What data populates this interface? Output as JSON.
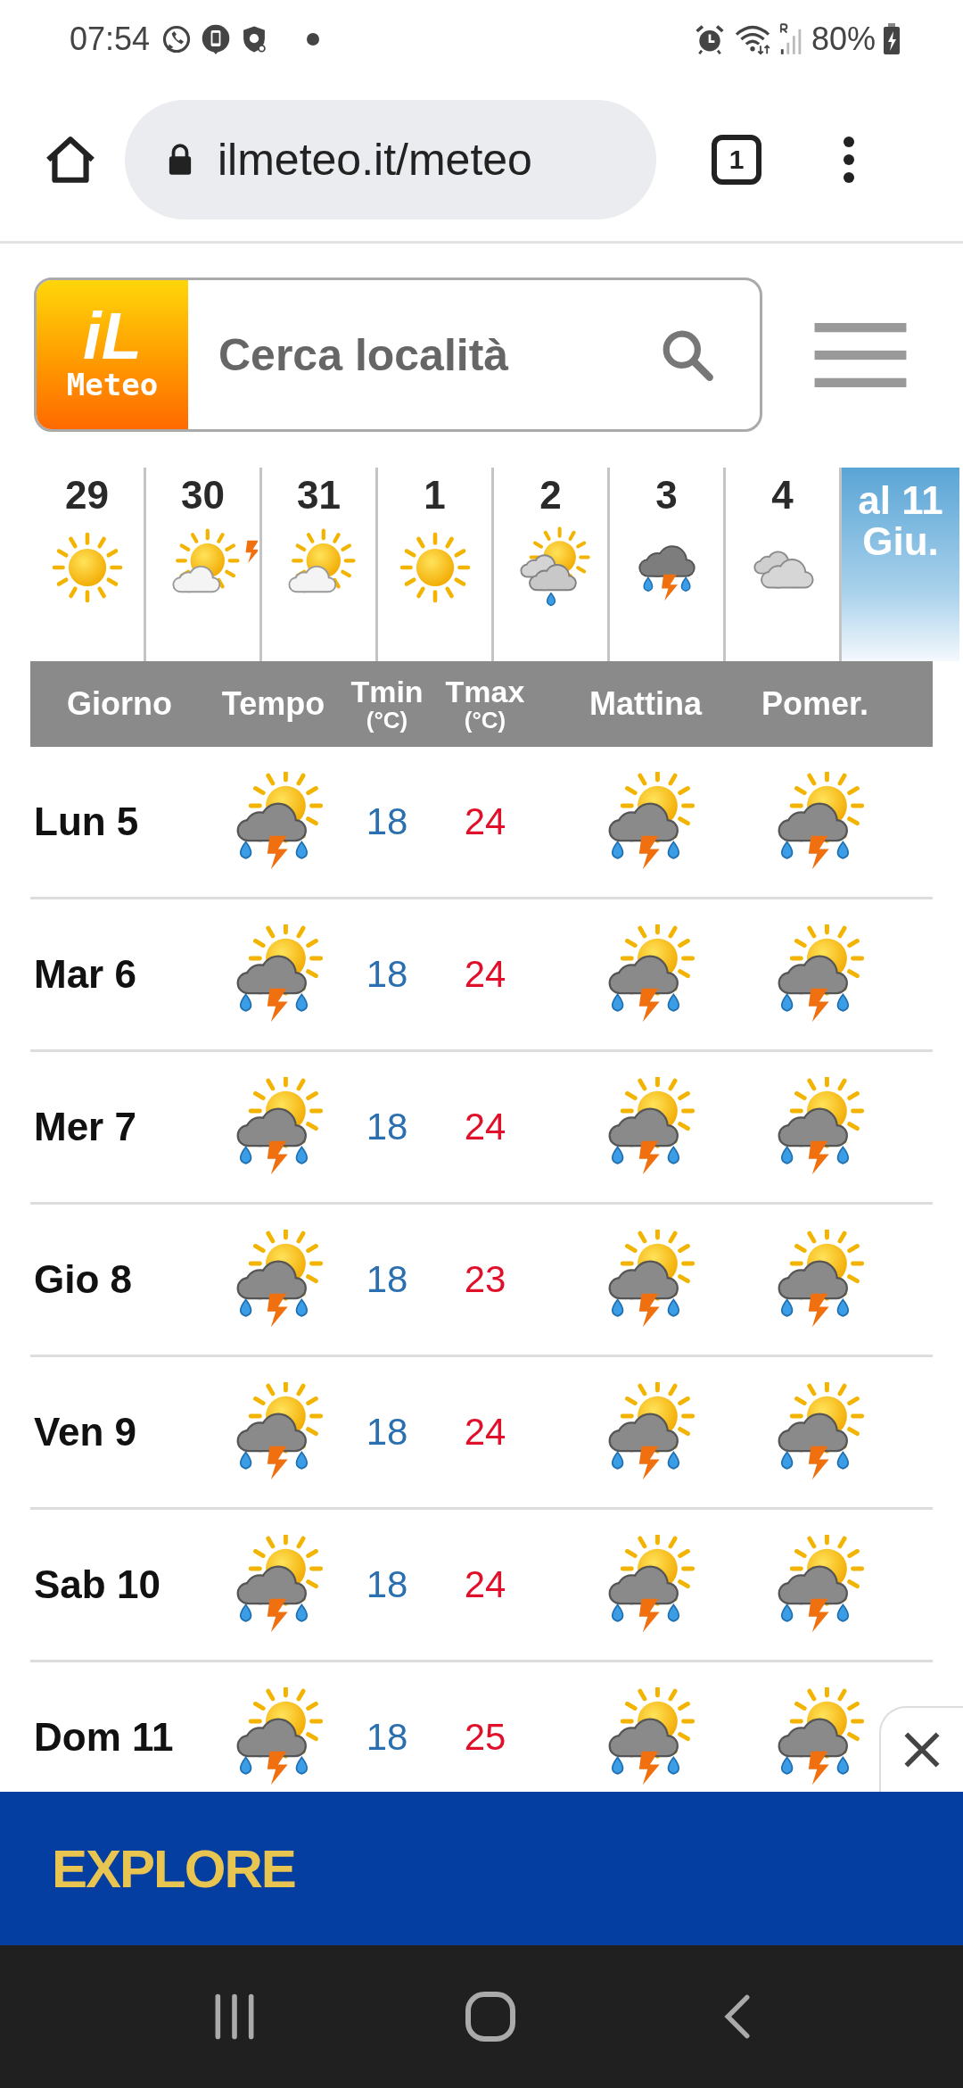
{
  "status_bar": {
    "time": "07:54",
    "battery": "80%"
  },
  "browser": {
    "url": "ilmeteo.it/meteo",
    "tab_count": "1"
  },
  "site_header": {
    "logo_top": "iL",
    "logo_bottom": "Meteo",
    "search": {
      "placeholder": "Cerca località"
    }
  },
  "day_strip": [
    {
      "day": "29",
      "kind": "sun",
      "alert": false
    },
    {
      "day": "30",
      "kind": "sun_cloud",
      "alert": true
    },
    {
      "day": "31",
      "kind": "sun_cloud",
      "alert": false
    },
    {
      "day": "1",
      "kind": "sun",
      "alert": false
    },
    {
      "day": "2",
      "kind": "sun_cloud_rain",
      "alert": false
    },
    {
      "day": "3",
      "kind": "storm",
      "alert": false
    },
    {
      "day": "4",
      "kind": "clouds",
      "alert": false
    }
  ],
  "range_panel": {
    "label": "al 11 Giu."
  },
  "table": {
    "columns": [
      {
        "label": "Giorno"
      },
      {
        "label": "Tempo"
      },
      {
        "label": "Tmin",
        "unit": "(°C)"
      },
      {
        "label": "Tmax",
        "unit": "(°C)"
      },
      {
        "label": "Mattina"
      },
      {
        "label": "Pomer."
      }
    ],
    "rows": [
      {
        "day": "Lun 5",
        "tmin": "18",
        "tmax": "24"
      },
      {
        "day": "Mar 6",
        "tmin": "18",
        "tmax": "24"
      },
      {
        "day": "Mer 7",
        "tmin": "18",
        "tmax": "24"
      },
      {
        "day": "Gio 8",
        "tmin": "18",
        "tmax": "23"
      },
      {
        "day": "Ven 9",
        "tmin": "18",
        "tmax": "24"
      },
      {
        "day": "Sab 10",
        "tmin": "18",
        "tmax": "24"
      },
      {
        "day": "Dom 11",
        "tmin": "18",
        "tmax": "25"
      }
    ]
  },
  "ad_banner": {
    "text": "EXPLORE"
  }
}
